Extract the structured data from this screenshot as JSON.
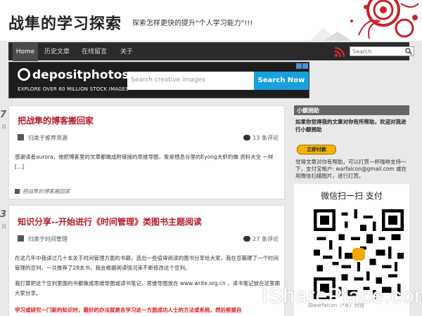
{
  "header": {
    "title": "战隼的学习探索",
    "description": "探索怎样更快的提升\"个人学习能力\"!!!"
  },
  "nav": {
    "items": [
      "Home",
      "历史文章",
      "在线留言",
      "关于"
    ]
  },
  "search": {
    "placeholder": "Search"
  },
  "ad": {
    "logo": "depositphotos",
    "tagline": "EXPLORE OVER 60 MILLION STOCK IMAGES",
    "search_placeholder": "Search creative images",
    "button": "Search Now"
  },
  "posts": [
    {
      "date_day": "7",
      "date_month": "月",
      "title": "把战隼的博客搬回家",
      "category": "归类于推荐资源",
      "comments": "13 条评论",
      "excerpt": "感谢读者aurora，他把博客里的文章都做成附链接的思维导图，象是栖息谷里的Eyong大虾的做 资料大全 一样 [...]",
      "tag": "把战隼的博客搬回家"
    },
    {
      "date_day": "3",
      "date_month": "月",
      "title": "知识分享--开始进行《时间管理》类图书主题阅读",
      "category": "归类于时间管理",
      "comments": "27 条评论",
      "paragraph1": "在这几年中我读过几十本关于时间管理方面的书籍，选出一些值得阅读的图书分享给大家，我在豆瓣建了一个时间管理的豆列，一共推荐了28本书，我会根据阅读情况来不断修改这个豆列。",
      "paragraph2": "我打算把这个豆列里面的书都做成思维导图或读书笔记，思维导图放在 www.write.org.cn ，读书笔记放在这里跟大家分享。",
      "paragraph3": "学习或研究一门新的知识时，最好的办法就是去学习这一方面成功人士的方法或系统，然后根据自"
    }
  ],
  "sidebar": {
    "heading": "小额捐助",
    "intro": "如果你觉得我的文章对你有所帮助，欢迎对我进行小额捐助",
    "donate_button": "立即付款",
    "text": "觉得文章对你有帮助，可以打赏一杯咖啡支持一下，支付宝帐户: warfalcon@gmail.com 或在用微信扫描图片，进行打赏。",
    "wechat_title": "微信扫一扫 支付",
    "qr_footer": "向warfalcon（*水）付钱"
  },
  "watermark": "ISharePlace.com",
  "colors": {
    "accent": "#b81b26",
    "nav_bg": "#2a2a2a",
    "ad_button": "#19a0dc",
    "donate": "#f4b300"
  }
}
